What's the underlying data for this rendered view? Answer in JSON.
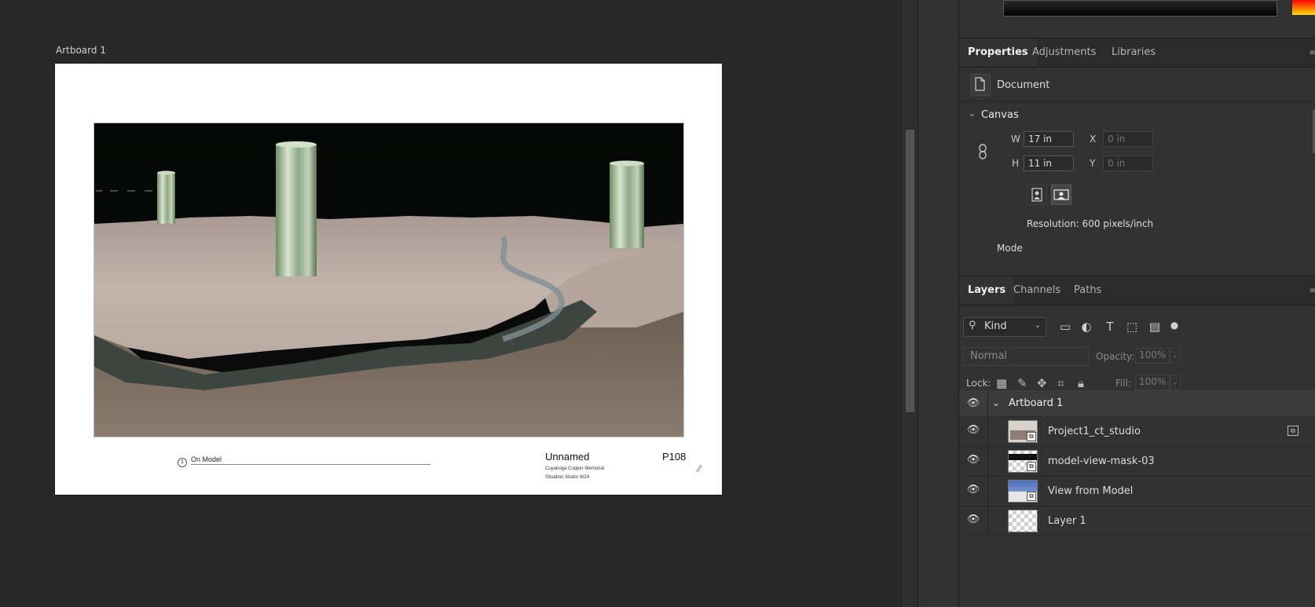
{
  "canvas": {
    "artboard_label": "Artboard 1",
    "title_block": {
      "view_number": "1",
      "view_label": "On Model",
      "title": "Unnamed",
      "sheet": "P108",
      "line1": "Cuyahoga Copper Memorial",
      "line2": "Situation Studio W24"
    }
  },
  "properties_tabs": [
    "Properties",
    "Adjustments",
    "Libraries"
  ],
  "properties": {
    "section_label": "Document",
    "canvas_heading": "Canvas",
    "w_label": "W",
    "w_value": "17 in",
    "h_label": "H",
    "h_value": "11 in",
    "x_label": "X",
    "x_placeholder": "0 in",
    "y_label": "Y",
    "y_placeholder": "0 in",
    "resolution": "Resolution: 600 pixels/inch",
    "mode_label": "Mode"
  },
  "layers_tabs": [
    "Layers",
    "Channels",
    "Paths"
  ],
  "layers_panel": {
    "filter_kind": "Kind",
    "blend_mode": "Normal",
    "opacity_label": "Opacity:",
    "opacity_value": "100%",
    "lock_label": "Lock:",
    "fill_label": "Fill:",
    "fill_value": "100%",
    "group_name": "Artboard 1",
    "layers": [
      {
        "name": "Project1_ct_studio"
      },
      {
        "name": "model-view-mask-03"
      },
      {
        "name": "View from Model"
      },
      {
        "name": "Layer 1"
      }
    ]
  },
  "colors": {
    "panel_bg": "#323232",
    "canvas_bg": "#282828",
    "ground": "#b8a8a0",
    "pillar": "#9fb896"
  }
}
